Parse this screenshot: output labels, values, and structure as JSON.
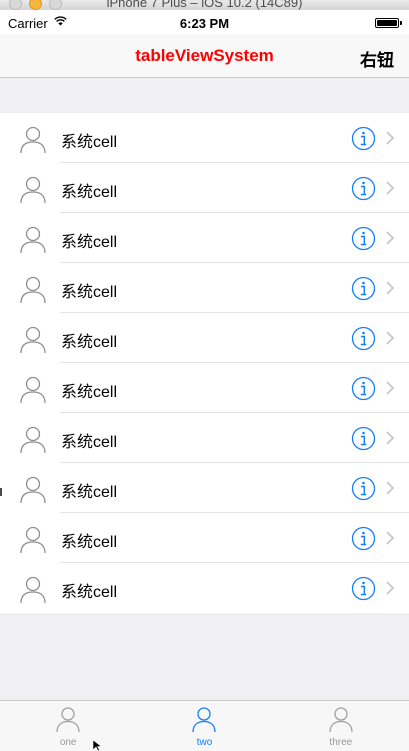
{
  "window": {
    "title": "iPhone 7 Plus – iOS 10.2 (14C89)"
  },
  "status_bar": {
    "carrier": "Carrier",
    "time": "6:23 PM",
    "wifi_icon": "wifi-icon",
    "battery_icon": "battery-icon"
  },
  "nav_bar": {
    "title": "tableViewSystem",
    "title_color": "#ff0000",
    "right_button": "右钮"
  },
  "table": {
    "rows": [
      {
        "label": "系统cell",
        "icon": "person-icon",
        "accessory": "info-icon"
      },
      {
        "label": "系统cell",
        "icon": "person-icon",
        "accessory": "info-icon"
      },
      {
        "label": "系统cell",
        "icon": "person-icon",
        "accessory": "info-icon"
      },
      {
        "label": "系统cell",
        "icon": "person-icon",
        "accessory": "info-icon"
      },
      {
        "label": "系统cell",
        "icon": "person-icon",
        "accessory": "info-icon"
      },
      {
        "label": "系统cell",
        "icon": "person-icon",
        "accessory": "info-icon"
      },
      {
        "label": "系统cell",
        "icon": "person-icon",
        "accessory": "info-icon"
      },
      {
        "label": "系统cell",
        "icon": "person-icon",
        "accessory": "info-icon"
      },
      {
        "label": "系统cell",
        "icon": "person-icon",
        "accessory": "info-icon"
      },
      {
        "label": "系统cell",
        "icon": "person-icon",
        "accessory": "info-icon"
      }
    ]
  },
  "tab_bar": {
    "tabs": [
      {
        "label": "one",
        "icon": "person-icon",
        "active": false
      },
      {
        "label": "two",
        "icon": "person-icon",
        "active": true
      },
      {
        "label": "three",
        "icon": "person-icon",
        "active": false
      }
    ],
    "active_color": "#147efb",
    "inactive_color": "#999999"
  },
  "colors": {
    "accent": "#147efb",
    "background": "#efeff4"
  }
}
